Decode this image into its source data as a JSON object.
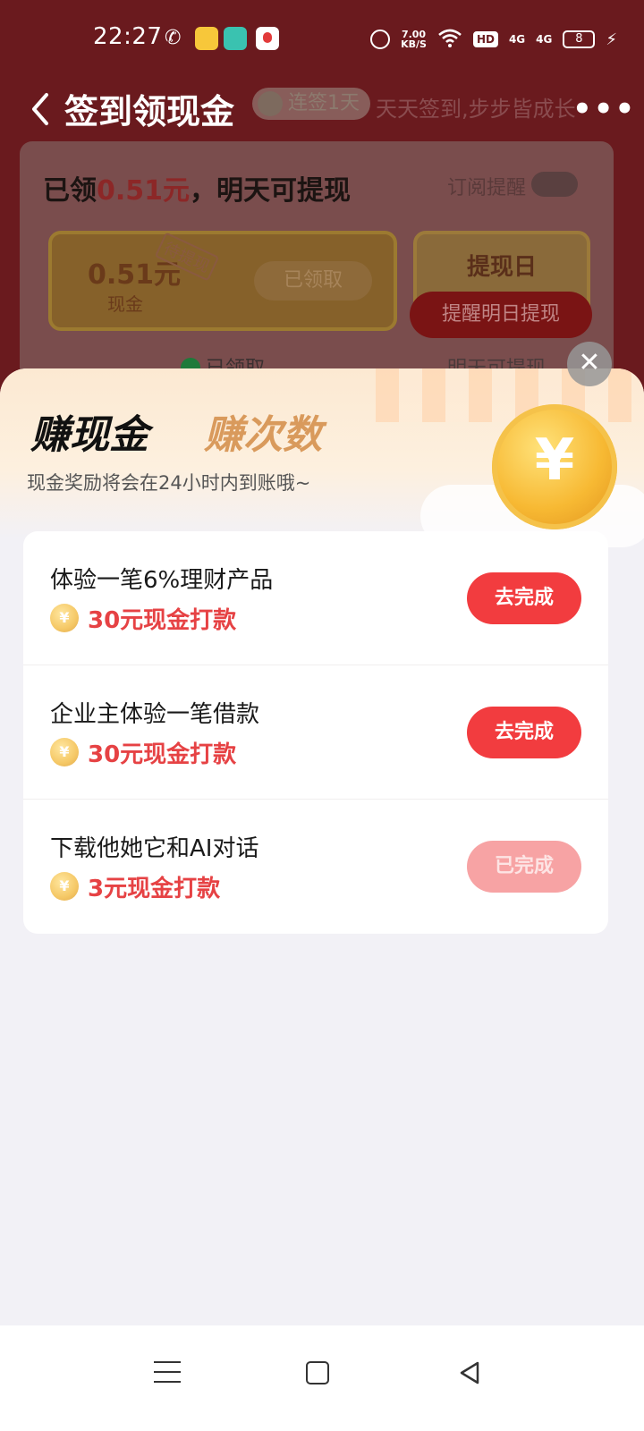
{
  "status_bar": {
    "time": "22:27",
    "speed_value": "7.00",
    "speed_unit": "KB/S",
    "hd": "HD",
    "signal_1": "4G",
    "signal_2": "4G",
    "battery": "8",
    "icons": [
      "wechat-icon",
      "app-icon",
      "app-icon",
      "app-icon",
      "alarm-icon",
      "wifi-icon",
      "bolt-icon"
    ]
  },
  "header": {
    "title": "签到领现金",
    "streak_badge": "连签1天",
    "slogan": "天天签到,步步皆成长"
  },
  "background_card": {
    "claimed_prefix": "已领",
    "claimed_amount": "0.51元",
    "claimed_suffix": "，明天可提现",
    "subscribe_label": "订阅提醒",
    "cash_amount": "0.51元",
    "cash_label": "现金",
    "pending_tag": "待提现",
    "claimed_button": "已领取",
    "withdraw_day": "提现日",
    "remind_button": "提醒明日提现",
    "claimed_status": "已领取",
    "tomorrow_status": "明天可提现"
  },
  "sheet": {
    "tab_earn_cash": "赚现金",
    "tab_earn_times": "赚次数",
    "subtitle": "现金奖励将会在24小时内到账哦~",
    "coin_symbol": "¥",
    "tasks": [
      {
        "title": "体验一笔6%理财产品",
        "reward": "30元现金打款",
        "button": "去完成",
        "status": "active"
      },
      {
        "title": "企业主体验一笔借款",
        "reward": "30元现金打款",
        "button": "去完成",
        "status": "active"
      },
      {
        "title": "下载他她它和AI对话",
        "reward": "3元现金打款",
        "button": "已完成",
        "status": "done"
      }
    ]
  },
  "colors": {
    "accent_red": "#f23c3f",
    "reward_red": "#e64244",
    "done_button": "#f7a3a4",
    "highlight_green": "#9bf07a"
  }
}
